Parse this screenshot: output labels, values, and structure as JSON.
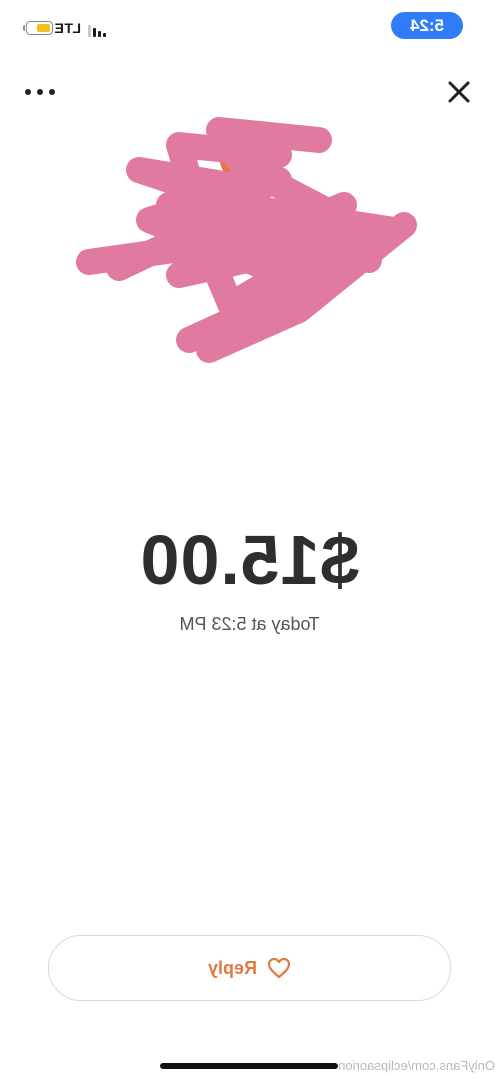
{
  "status_bar": {
    "time": "5:24",
    "network": "LTE",
    "battery_level": 0.6,
    "battery_color": "#f2c21b",
    "time_pill_color": "#2f7cf6"
  },
  "header": {
    "close_icon": "close-icon",
    "more_icon": "more-horizontal-icon"
  },
  "avatar": {
    "icon": "avatar-icon",
    "censor_color": "#e07aa0",
    "avatar_color": "#e8753d",
    "redacted": true
  },
  "tip": {
    "amount": "$15.00",
    "timestamp": "Today at 5:23 PM"
  },
  "actions": {
    "reply_label": "Reply",
    "reply_icon": "heart-icon",
    "accent_color": "#e07a3f"
  },
  "footer": {
    "watermark": "OnlyFans.com/eclipsaorion"
  },
  "display": {
    "mirrored": true
  }
}
